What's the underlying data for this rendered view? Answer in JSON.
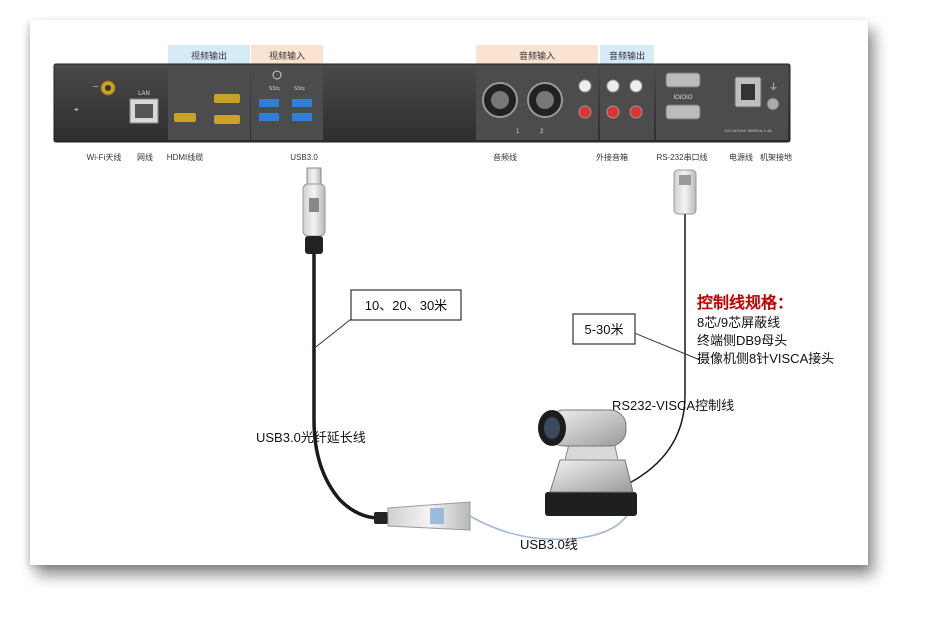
{
  "panel": {
    "sections": {
      "video_out": "视频输出",
      "video_in": "视频输入",
      "audio_in": "音频输入",
      "audio_out": "音频输出"
    },
    "port_labels": {
      "wifi": "Wi-Fi天线",
      "lan": "网线",
      "hdmi": "HDMI线缆",
      "usb": "USB3.0",
      "audio_line": "音频线",
      "speaker": "外接音箱",
      "rs232": "RS-232串口线",
      "power": "电源线",
      "ground": "机架接地"
    },
    "small_marks": {
      "lan": "LAN",
      "usb_a": "SS⇆",
      "usb_b": "SS⇆",
      "xlr_1": "1",
      "xlr_2": "2",
      "power_rating": "100-240VAC 50/60Hz 1.4A"
    }
  },
  "callouts": {
    "usb_length": "10、20、30米",
    "rs232_length": "5-30米"
  },
  "spec": {
    "title": "控制线规格：",
    "lines": [
      "8芯/9芯屏蔽线",
      "终端侧DB9母头",
      "摄像机侧8针VISCA接头"
    ],
    "title_color": "#c00000"
  },
  "cable_labels": {
    "fiber": "USB3.0光纤延长线",
    "usb_short": "USB3.0线",
    "visca": "RS232-VISCA控制线"
  },
  "colors": {
    "video_section": "#d6ebf7",
    "audio_in_section": "#fbe3d2",
    "panel": "#3d3d3d"
  }
}
